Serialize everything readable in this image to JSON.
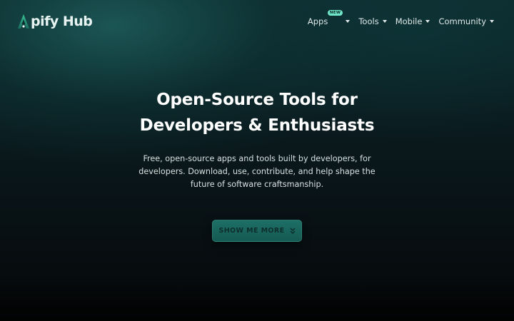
{
  "brand": {
    "logo_text": "pify Hub",
    "accent": "#6ee7c8",
    "logo_gradient": [
      "#2fae86",
      "#1a6d61"
    ]
  },
  "nav": {
    "items": [
      {
        "label": "Apps",
        "badge": "NEW",
        "icon": "chevron-down-icon"
      },
      {
        "label": "Tools",
        "icon": "chevron-down-icon"
      },
      {
        "label": "Mobile",
        "icon": "chevron-down-icon"
      },
      {
        "label": "Community",
        "icon": "chevron-down-icon"
      }
    ]
  },
  "hero": {
    "title_line1": "Open-Source Tools for",
    "title_line2": "Developers & Enthusiasts",
    "subtitle": "Free, open-source apps and tools built by developers, for developers. Download, use, contribute, and help shape the future of software craftsmanship.",
    "cta_label": "SHOW ME MORE",
    "cta_icon": "double-chevron-down-icon",
    "cta_color": "#1d6f66"
  },
  "colors": {
    "background_top": "#0d2b2e",
    "background_bottom": "#050708",
    "text": "#ffffff"
  }
}
